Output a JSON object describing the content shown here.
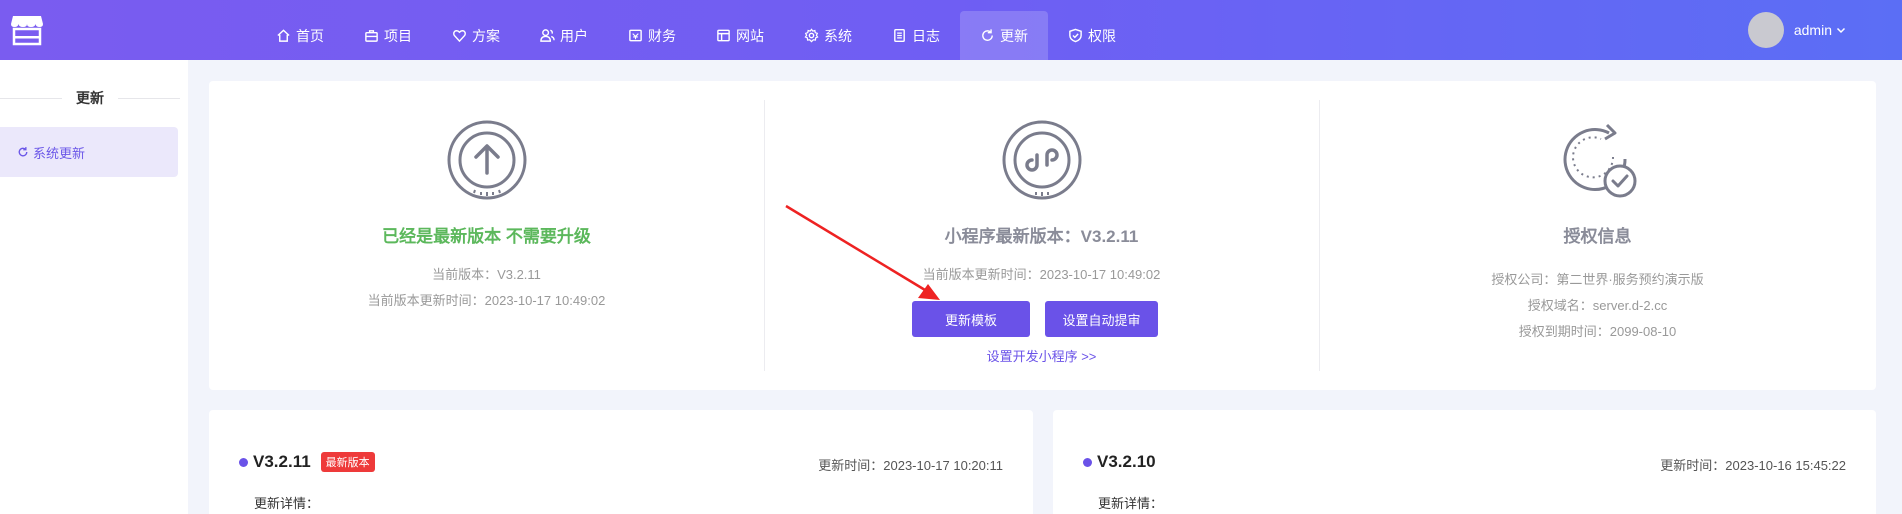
{
  "nav": {
    "items": [
      {
        "label": "首页",
        "icon": "home-icon"
      },
      {
        "label": "项目",
        "icon": "briefcase-icon"
      },
      {
        "label": "方案",
        "icon": "heart-icon"
      },
      {
        "label": "用户",
        "icon": "users-icon"
      },
      {
        "label": "财务",
        "icon": "wallet-icon"
      },
      {
        "label": "网站",
        "icon": "website-icon"
      },
      {
        "label": "系统",
        "icon": "gear-icon"
      },
      {
        "label": "日志",
        "icon": "log-icon"
      },
      {
        "label": "更新",
        "icon": "refresh-icon",
        "active": true
      },
      {
        "label": "权限",
        "icon": "shield-icon"
      }
    ],
    "user": "admin",
    "accent": "#6a52e8"
  },
  "sidebar": {
    "title": "更新",
    "items": [
      {
        "label": "系统更新",
        "icon": "refresh-icon"
      }
    ]
  },
  "status": {
    "title": "已经是最新版本 不需要升级",
    "title_color": "#5cb85c",
    "current_version": "当前版本：V3.2.11",
    "updated_at": "当前版本更新时间：2023-10-17 10:49:02"
  },
  "miniprogram": {
    "title": "小程序最新版本：V3.2.11",
    "updated_at": "当前版本更新时间：2023-10-17 10:49:02",
    "update_button": "更新模板",
    "audit_button": "设置自动提审",
    "dev_link": "设置开发小程序 >>"
  },
  "license": {
    "title": "授权信息",
    "company": "授权公司：第二世界·服务预约演示版",
    "domain": "授权域名：server.d-2.cc",
    "expiry": "授权到期时间：2099-08-10"
  },
  "versions": [
    {
      "name": "V3.2.11",
      "badge": "最新版本",
      "time": "更新时间：2023-10-17 10:20:11",
      "detail": "更新详情："
    },
    {
      "name": "V3.2.10",
      "time": "更新时间：2023-10-16 15:45:22",
      "detail": "更新详情："
    }
  ],
  "colors": {
    "annotation_arrow": "#ee2222",
    "badge": "#ee3a3a"
  }
}
